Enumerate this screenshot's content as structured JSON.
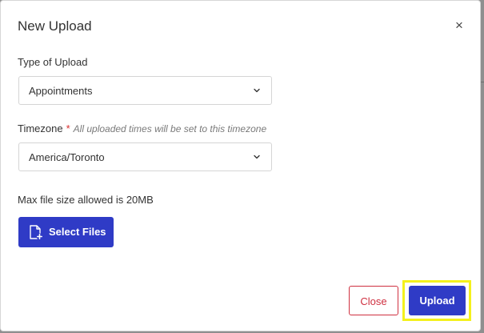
{
  "modal": {
    "title": "New Upload",
    "close_glyph": "×"
  },
  "upload_type": {
    "label": "Type of Upload",
    "selected": "Appointments"
  },
  "timezone": {
    "label": "Timezone",
    "required_marker": "*",
    "hint": "All uploaded times will be set to this timezone",
    "selected": "America/Toronto"
  },
  "files": {
    "max_size_text": "Max file size allowed is 20MB",
    "select_label": "Select Files"
  },
  "footer": {
    "close_label": "Close",
    "upload_label": "Upload"
  },
  "colors": {
    "primary": "#2f3bc6",
    "danger": "#cf3040",
    "highlight": "#f4f11c"
  },
  "icons": {
    "close": "close-icon",
    "chevron": "chevron-down-icon",
    "file_add": "file-add-icon"
  }
}
